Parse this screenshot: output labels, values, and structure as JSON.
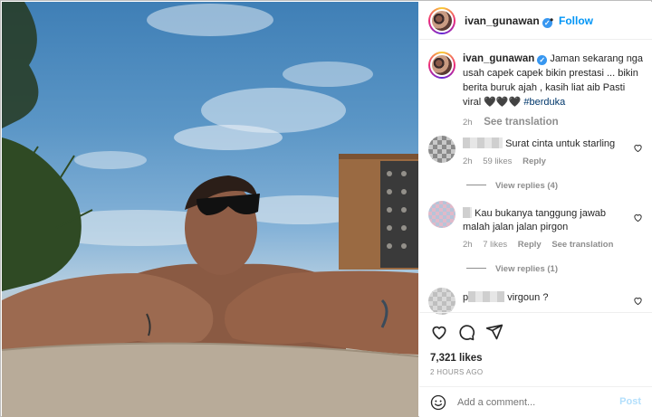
{
  "header": {
    "username": "ivan_gunawan",
    "separator": "•",
    "follow_label": "Follow"
  },
  "caption": {
    "username": "ivan_gunawan",
    "text": "Jaman sekarang nga usah capek capek bikin prestasi ... bikin berita buruk ajah , kasih liat aib Pasti viral",
    "hearts": "🖤🖤🖤",
    "hashtag": "#berduka",
    "time": "2h",
    "see_translation": "See translation"
  },
  "comments": [
    {
      "text": "Surat cinta untuk starling",
      "time": "2h",
      "likes": "59 likes",
      "reply": "Reply",
      "view_replies": "View replies (4)"
    },
    {
      "text": "Kau bukanya tanggung jawab malah jalan jalan pirgon",
      "time": "2h",
      "likes": "7 likes",
      "reply": "Reply",
      "see_translation": "See translation",
      "view_replies": "View replies (1)"
    },
    {
      "username_fragment": "p",
      "text": "virgoun ?"
    }
  ],
  "actions": {
    "like_icon": "heart-icon",
    "comment_icon": "comment-icon",
    "share_icon": "share-icon",
    "likes": "7,321 likes",
    "ago": "2 HOURS AGO"
  },
  "add_comment": {
    "placeholder": "Add a comment...",
    "post_label": "Post",
    "emoji_icon": "emoji-icon"
  },
  "colors": {
    "accent": "#0095f6",
    "verified": "#3897f0",
    "muted": "#8e8e8e",
    "hashtag": "#00376b"
  }
}
